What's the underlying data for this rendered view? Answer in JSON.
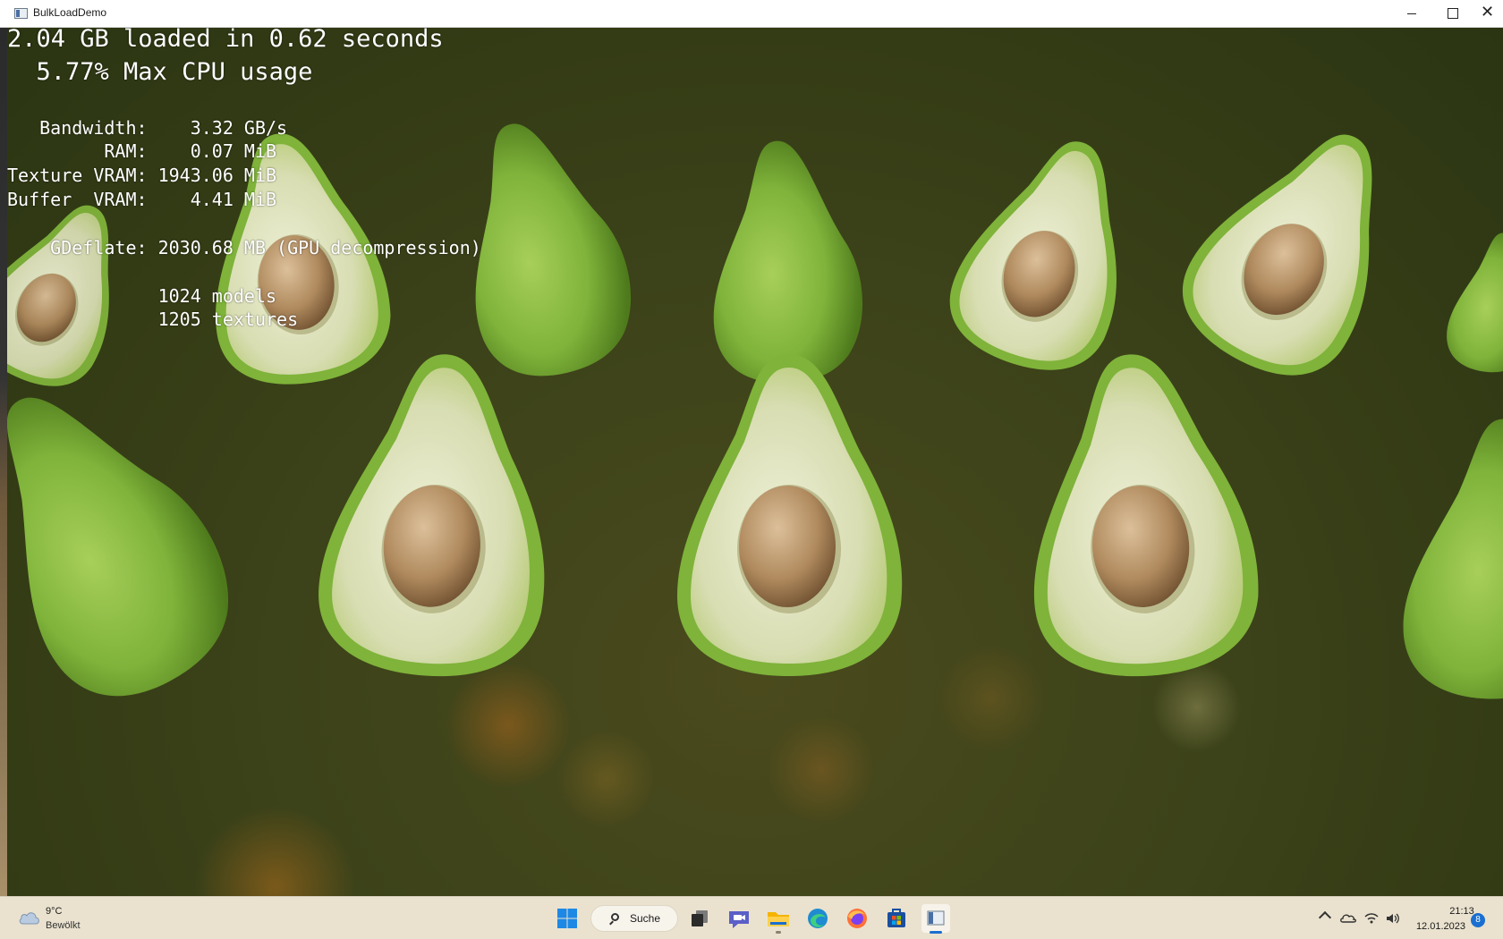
{
  "window": {
    "title": "BulkLoadDemo",
    "controls": {
      "close_glyph": "✕"
    }
  },
  "overlay": {
    "headline": "2.04 GB loaded in 0.62 seconds",
    "cpu": "  5.77% Max CPU usage",
    "stats": [
      "   Bandwidth:    3.32 GB/s",
      "         RAM:    0.07 MiB",
      "Texture VRAM: 1943.06 MiB",
      "Buffer  VRAM:    4.41 MiB"
    ],
    "gdeflate": "    GDeflate: 2030.68 MB (GPU decompression)",
    "counts": [
      "              1024 models",
      "              1205 textures"
    ]
  },
  "scene": {
    "subject": "avocado models",
    "colors": {
      "skin": "#6a9e2a",
      "flesh": "#e4e6c8",
      "pit": "#b08a5e",
      "background": "#3c4219"
    }
  },
  "taskbar": {
    "weather": {
      "temp": "9°C",
      "desc": "Bewölkt",
      "icon": "cloud-icon"
    },
    "search_label": "Suche",
    "apps": [
      "start-icon",
      "task-view-icon",
      "teams-chat-icon",
      "file-explorer-icon",
      "edge-icon",
      "firefox-icon",
      "store-icon",
      "bulkloaddemo-icon"
    ],
    "tray": [
      "chevron-up-icon",
      "onedrive-icon",
      "wifi-icon",
      "volume-icon"
    ],
    "clock": {
      "time": "21:13",
      "date": "12.01.2023"
    },
    "notifications": "8",
    "accent": "#1a6fd0"
  }
}
